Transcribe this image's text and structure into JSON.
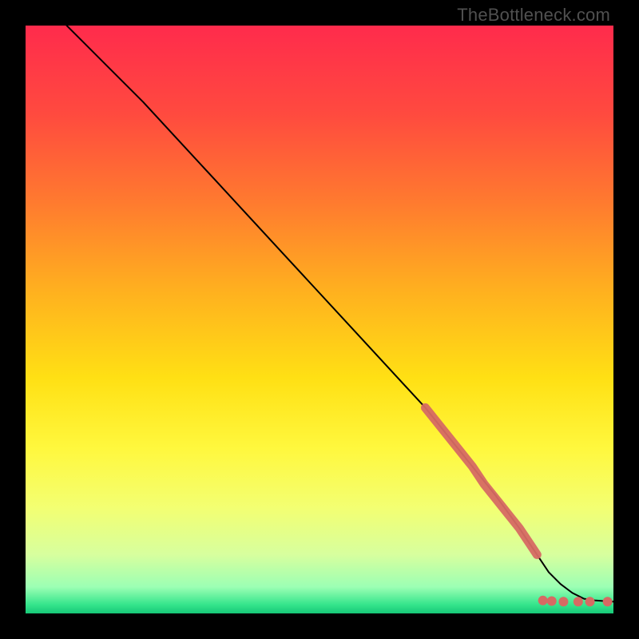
{
  "watermark": "TheBottleneck.com",
  "chart_data": {
    "type": "line",
    "title": "",
    "xlabel": "",
    "ylabel": "",
    "xlim": [
      0,
      100
    ],
    "ylim": [
      0,
      100
    ],
    "grid": false,
    "comment": "Axes have no visible tick labels; values are normalized 0–100 on both axes, estimated from pixel positions.",
    "series": [
      {
        "name": "curve",
        "style": "line-black",
        "x": [
          7,
          10,
          14,
          20,
          26,
          32,
          38,
          44,
          50,
          56,
          62,
          68,
          72,
          76,
          80,
          84,
          87,
          89,
          91,
          93,
          95,
          97,
          100
        ],
        "y": [
          100,
          97,
          93,
          87,
          80.5,
          74,
          67.5,
          61,
          54.5,
          48,
          41.5,
          35,
          30,
          25,
          20,
          14.5,
          10,
          7,
          5,
          3.5,
          2.5,
          2.2,
          2
        ]
      },
      {
        "name": "highlight-segment",
        "style": "thick-salmon",
        "x": [
          68,
          70,
          72,
          74,
          76,
          78,
          80,
          82,
          84,
          86,
          87
        ],
        "y": [
          35,
          32.5,
          30,
          27.5,
          25,
          22,
          19.5,
          17,
          14.5,
          11.5,
          10
        ]
      },
      {
        "name": "tail-dots",
        "style": "dots-salmon",
        "x": [
          88,
          89.5,
          91.5,
          94,
          96,
          99
        ],
        "y": [
          2.2,
          2.1,
          2.0,
          2.0,
          2.0,
          2.0
        ]
      }
    ],
    "colors": {
      "curve": "#000000",
      "highlight": "#d66a63",
      "background_gradient": [
        "#ff2b4c",
        "#ff6a3c",
        "#ffb300",
        "#ffe100",
        "#f7ff52",
        "#eaff8a",
        "#b8ffb0",
        "#2bdc82"
      ]
    }
  }
}
